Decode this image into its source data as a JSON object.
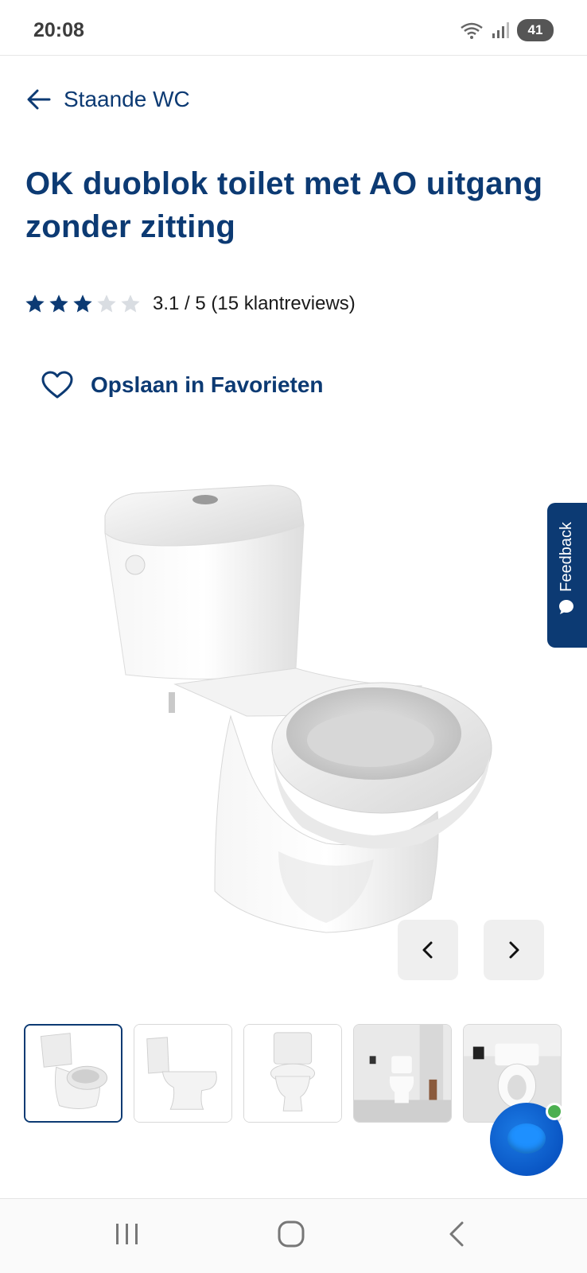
{
  "status_bar": {
    "time": "20:08",
    "battery": "41",
    "wifi_icon": "wifi-icon",
    "signal_icon": "signal-icon"
  },
  "back_link": {
    "label": "Staande WC",
    "icon": "arrow-left-icon"
  },
  "product": {
    "title": "OK duoblok toilet met AO uitgang zonder zitting",
    "rating_value": 3.1,
    "rating_max": 5,
    "rating_text": "3.1 / 5 (15 klantreviews)",
    "favorite_label": "Opslaan in Favorieten",
    "favorite_icon": "heart-outline-icon"
  },
  "gallery": {
    "prev_icon": "chevron-left-icon",
    "next_icon": "chevron-right-icon",
    "active_index": 0,
    "thumbnail_count": 5
  },
  "feedback": {
    "label": "Feedback",
    "icon": "chat-bubble-icon"
  },
  "chat": {
    "icon": "chat-assistant-icon",
    "status": "online"
  },
  "colors": {
    "brand": "#0c3a73",
    "star_filled": "#0c3a73",
    "star_empty": "#d9dde2",
    "online": "#4caf50"
  },
  "nav_bar": {
    "recents_icon": "recents-icon",
    "home_icon": "home-icon",
    "back_icon": "back-icon"
  }
}
